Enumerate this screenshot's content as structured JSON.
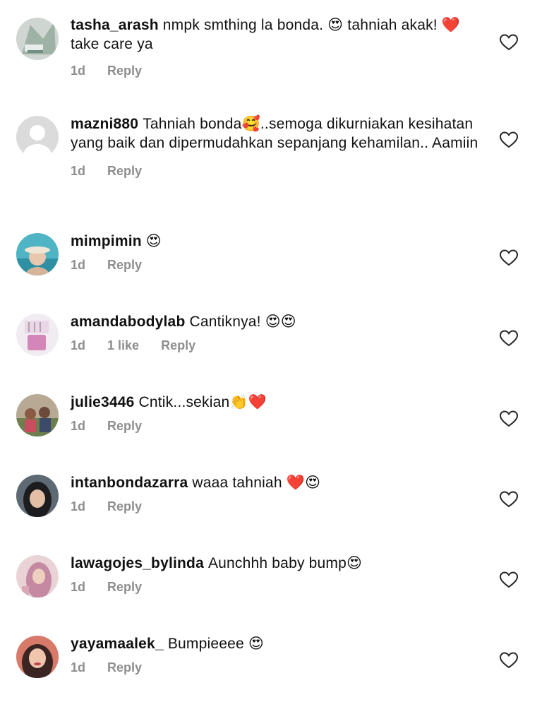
{
  "comments": [
    {
      "username": "tasha_arash",
      "text": "nmpk smthing la bonda. 😍 tahniah akak! ❤️ take care ya",
      "time": "1d",
      "likes": "",
      "reply_label": "Reply"
    },
    {
      "username": "mazni880",
      "text": "Tahniah bonda🥰..semoga dikurniakan kesihatan yang baik dan dipermudahkan sepanjang kehamilan.. Aamiin",
      "time": "1d",
      "likes": "",
      "reply_label": "Reply"
    },
    {
      "username": "mimpimin",
      "text": "😍",
      "time": "1d",
      "likes": "",
      "reply_label": "Reply"
    },
    {
      "username": "amandabodylab",
      "text": "Cantiknya! 😍😍",
      "time": "1d",
      "likes": "1 like",
      "reply_label": "Reply"
    },
    {
      "username": "julie3446",
      "text": "Cntik...sekian👏❤️",
      "time": "1d",
      "likes": "",
      "reply_label": "Reply"
    },
    {
      "username": "intanbondazarra",
      "text": "waaa tahniah ❤️😍",
      "time": "1d",
      "likes": "",
      "reply_label": "Reply"
    },
    {
      "username": "lawagojes_bylinda",
      "text": "Aunchhh baby bump😍",
      "time": "1d",
      "likes": "",
      "reply_label": "Reply"
    },
    {
      "username": "yayamaalek_",
      "text": "Bumpieeee 😍",
      "time": "1d",
      "likes": "",
      "reply_label": "Reply"
    }
  ],
  "colors": {
    "meta_gray": "#8e8e8e",
    "text": "#111111",
    "heart_outline": "#262626"
  },
  "icons": {
    "like": "heart-outline-icon"
  }
}
